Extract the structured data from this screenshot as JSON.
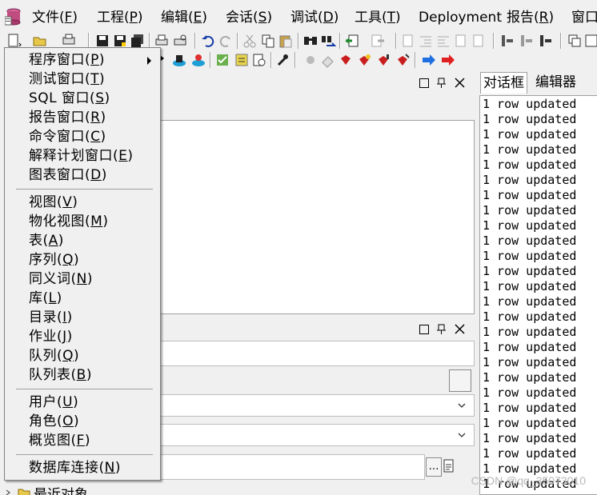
{
  "menubar": {
    "items": [
      {
        "label": "文件(",
        "key": "F",
        "close": ")"
      },
      {
        "label": "工程(",
        "key": "P",
        "close": ")"
      },
      {
        "label": "编辑(",
        "key": "E",
        "close": ")"
      },
      {
        "label": "会话(",
        "key": "S",
        "close": ")"
      },
      {
        "label": "调试(",
        "key": "D",
        "close": ")"
      },
      {
        "label": "工具(",
        "key": "T",
        "close": ")"
      },
      {
        "label": "Deployment",
        "key": "",
        "close": ""
      },
      {
        "label": "报告(",
        "key": "R",
        "close": ")"
      },
      {
        "label": "窗口",
        "key": "",
        "close": ""
      }
    ]
  },
  "dropdown": {
    "items": [
      {
        "pre": "程序窗口(",
        "key": "P",
        "post": ")"
      },
      {
        "pre": "测试窗口(",
        "key": "T",
        "post": ")"
      },
      {
        "pre": "SQL 窗口(",
        "key": "S",
        "post": ")"
      },
      {
        "pre": "报告窗口(",
        "key": "R",
        "post": ")"
      },
      {
        "pre": "命令窗口(",
        "key": "C",
        "post": ")"
      },
      {
        "pre": "解释计划窗口(",
        "key": "E",
        "post": ")"
      },
      {
        "pre": "图表窗口(",
        "key": "D",
        "post": ")"
      },
      {
        "pre": "视图(",
        "key": "V",
        "post": ")"
      },
      {
        "pre": "物化视图(",
        "key": "M",
        "post": ")"
      },
      {
        "pre": "表(",
        "key": "A",
        "post": ")"
      },
      {
        "pre": "序列(",
        "key": "Q",
        "post": ")"
      },
      {
        "pre": "同义词(",
        "key": "N",
        "post": ")"
      },
      {
        "pre": "库(",
        "key": "L",
        "post": ")"
      },
      {
        "pre": "目录(",
        "key": "I",
        "post": ")"
      },
      {
        "pre": "作业(",
        "key": "J",
        "post": ")"
      },
      {
        "pre": "队列(",
        "key": "Q",
        "post": ")"
      },
      {
        "pre": "队列表(",
        "key": "B",
        "post": ")"
      },
      {
        "pre": "用户(",
        "key": "U",
        "post": ")"
      },
      {
        "pre": "角色(",
        "key": "O",
        "post": ")"
      },
      {
        "pre": "概览图(",
        "key": "F",
        "post": ")"
      },
      {
        "pre": "数据库连接(",
        "key": "N",
        "post": ")"
      }
    ]
  },
  "right_panel": {
    "tabs": [
      "对话框",
      "编辑器"
    ],
    "output_line": "1 row updated",
    "line_count": 26
  },
  "bottom": {
    "tree_item": "最近对象"
  },
  "watermark": "CSDN @qq_35073010",
  "colors": {
    "accent_blue": "#1e6fe0",
    "accent_red": "#e02020"
  }
}
